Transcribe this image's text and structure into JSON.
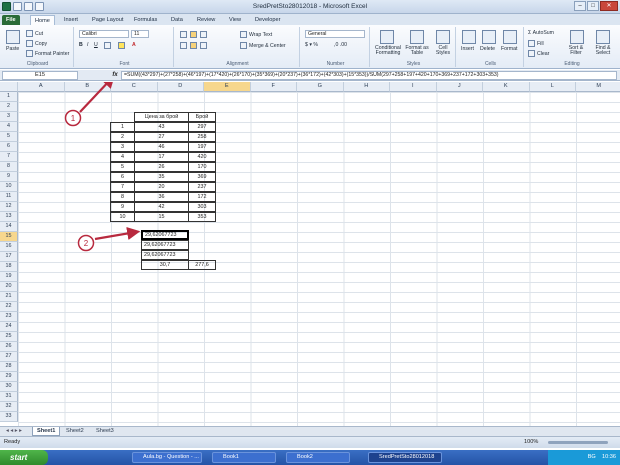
{
  "window": {
    "title": "SredPretSto28012018 - Microsoft Excel"
  },
  "ribbon_tabs": [
    "File",
    "Home",
    "Insert",
    "Page Layout",
    "Formulas",
    "Data",
    "Review",
    "View",
    "Developer"
  ],
  "clipboard": {
    "paste": "Paste",
    "cut": "Cut",
    "copy": "Copy",
    "format_painter": "Format Painter",
    "label": "Clipboard"
  },
  "font": {
    "name": "Calibri",
    "size": "11",
    "label": "Font"
  },
  "alignment": {
    "wrap": "Wrap Text",
    "merge": "Merge & Center",
    "label": "Alignment"
  },
  "number": {
    "format": "General",
    "label": "Number"
  },
  "styles": {
    "cond": "Conditional Formatting",
    "table": "Format as Table",
    "cell": "Cell Styles",
    "label": "Styles"
  },
  "cells": {
    "insert": "Insert",
    "delete": "Delete",
    "format": "Format",
    "label": "Cells"
  },
  "editing": {
    "autosum": "AutoSum",
    "fill": "Fill",
    "clear": "Clear",
    "sort": "Sort & Filter",
    "find": "Find & Select",
    "label": "Editing"
  },
  "formula_bar": {
    "name_box": "E15",
    "fx": "fx",
    "formula": "=SUM((43*297)+(27*258)+(46*197)+(17*420)+(26*170)+(35*369)+(20*237)+(36*172)+(42*303)+(15*353))/SUM(297+258+197+420+170+369+237+172+303+353)"
  },
  "columns": [
    "A",
    "B",
    "C",
    "D",
    "E",
    "F",
    "G",
    "H",
    "I",
    "J",
    "K",
    "L",
    "M",
    "N",
    "O",
    "P",
    "Q"
  ],
  "rows": [
    "1",
    "2",
    "3",
    "4",
    "5",
    "6",
    "7",
    "8",
    "9",
    "10",
    "11",
    "12",
    "13",
    "14",
    "15",
    "16",
    "17",
    "18",
    "19",
    "20",
    "21",
    "22",
    "23",
    "24",
    "25",
    "26",
    "27",
    "28",
    "29",
    "30",
    "31",
    "32",
    "33"
  ],
  "table": {
    "headers": [
      "Цена за брой",
      "Брой"
    ],
    "rows": [
      [
        "1",
        "43",
        "297"
      ],
      [
        "2",
        "27",
        "258"
      ],
      [
        "3",
        "46",
        "197"
      ],
      [
        "4",
        "17",
        "420"
      ],
      [
        "5",
        "26",
        "170"
      ],
      [
        "6",
        "35",
        "369"
      ],
      [
        "7",
        "20",
        "237"
      ],
      [
        "8",
        "36",
        "172"
      ],
      [
        "9",
        "42",
        "303"
      ],
      [
        "10",
        "15",
        "353"
      ]
    ]
  },
  "results": [
    "29,62067723",
    "29,62067723",
    "29,62067723"
  ],
  "totals": [
    "30,7",
    "277,6"
  ],
  "annotations": [
    "1",
    "2"
  ],
  "sheets": [
    "Sheet1",
    "Sheet2",
    "Sheet3"
  ],
  "status": {
    "ready": "Ready",
    "zoom": "100%"
  },
  "taskbar": {
    "start": "start",
    "items": [
      "Aula.bg - Question - ...",
      "Book1",
      "Book2",
      "SredPretSto28012018"
    ],
    "lang": "BG",
    "clock": "10:36"
  },
  "colors": {
    "annotation": "#b8293e",
    "selected_header": "#f7d78d",
    "file_tab": "#2a6b37"
  }
}
